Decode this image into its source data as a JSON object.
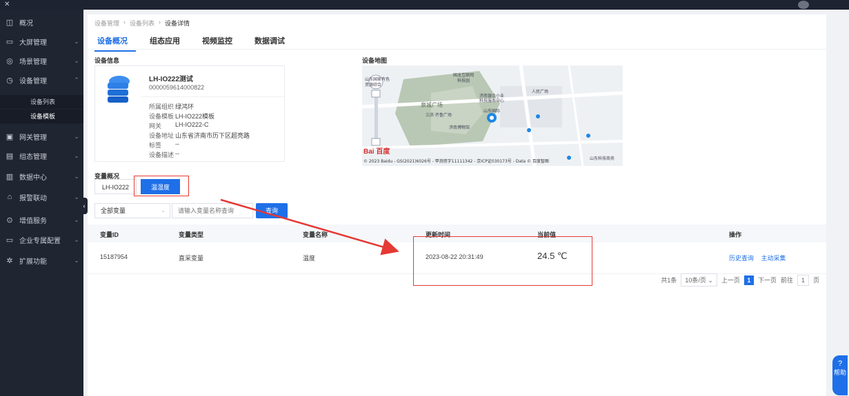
{
  "sidebar": {
    "items": [
      {
        "label": "概况",
        "icon": "overview-icon",
        "glyph": "◫"
      },
      {
        "label": "大屏管理",
        "icon": "monitor-icon",
        "glyph": "▭"
      },
      {
        "label": "场景管理",
        "icon": "scene-icon",
        "glyph": "◎"
      },
      {
        "label": "设备管理",
        "icon": "device-icon",
        "glyph": "◷"
      },
      {
        "label": "网关管理",
        "icon": "gateway-icon",
        "glyph": "▣"
      },
      {
        "label": "组态管理",
        "icon": "config-icon",
        "glyph": "▤"
      },
      {
        "label": "数据中心",
        "icon": "data-chart-icon",
        "glyph": "▥"
      },
      {
        "label": "报警联动",
        "icon": "alarm-icon",
        "glyph": "⌂"
      },
      {
        "label": "增值服务",
        "icon": "service-icon",
        "glyph": "⊙"
      },
      {
        "label": "企业专属配置",
        "icon": "enterprise-icon",
        "glyph": "▭"
      },
      {
        "label": "扩展功能",
        "icon": "extension-icon",
        "glyph": "✲"
      }
    ],
    "sub_items": [
      "设备列表",
      "设备模板"
    ]
  },
  "breadcrumb": [
    "设备管理",
    "设备列表",
    "设备详情"
  ],
  "tabs": [
    "设备概况",
    "组态应用",
    "视频监控",
    "数据调试"
  ],
  "sections": {
    "info": "设备信息",
    "map": "设备地图",
    "vars": "变量概况"
  },
  "device": {
    "name": "LH-IO222测试",
    "id": "0000059614000822",
    "fields": [
      {
        "k": "所属组织",
        "v": "绿鸿环"
      },
      {
        "k": "设备模板",
        "v": "LH-IO222模板"
      },
      {
        "k": "网关",
        "v": "LH-IO222-C"
      },
      {
        "k": "设备地址",
        "v": "山东省济南市历下区超亮路"
      },
      {
        "k": "标签",
        "v": "--"
      },
      {
        "k": "设备描述",
        "v": "--"
      }
    ]
  },
  "map": {
    "labels": [
      "山东国家有色",
      "资源综合",
      "国龙互联网",
      "科技园",
      "泉城广场",
      "人民广场",
      "三庆·齐鲁广场",
      "济南银企小业",
      "科技服务中心",
      "山东国际",
      "济南博物馆",
      "济南酒店"
    ],
    "copyright": "© 2023 Baidu - GS(2021)6026号 - 甲测资字11111342 - 京ICP证030173号 - Data © 百度智图",
    "logo": "Bai 百度",
    "corner_label": "山东科技商务"
  },
  "var_tags": [
    "LH-IO222",
    "温湿度"
  ],
  "filter": {
    "select_value": "全部变量",
    "input_placeholder": "请输入变量名称查询",
    "button": "查询"
  },
  "table": {
    "headers": [
      "变量ID",
      "变量类型",
      "变量名称",
      "更新时间",
      "当前值",
      "操作"
    ],
    "rows": [
      {
        "id": "15187954",
        "type": "直采变量",
        "name": "温度",
        "time": "2023-08-22 20:31:49",
        "value": "24.5 ℃",
        "actions": [
          "历史查询",
          "主动采集"
        ]
      }
    ]
  },
  "pager": {
    "total": "共1条",
    "size": "10条/页",
    "prev": "上一页",
    "page": "1",
    "next": "下一页",
    "goto": "前往",
    "goto_value": "1",
    "unit": "页"
  },
  "help": {
    "label": "帮助"
  },
  "colors": {
    "accent": "#1e6fe8",
    "annotation": "#e53935",
    "sidebar": "#1f2531"
  }
}
